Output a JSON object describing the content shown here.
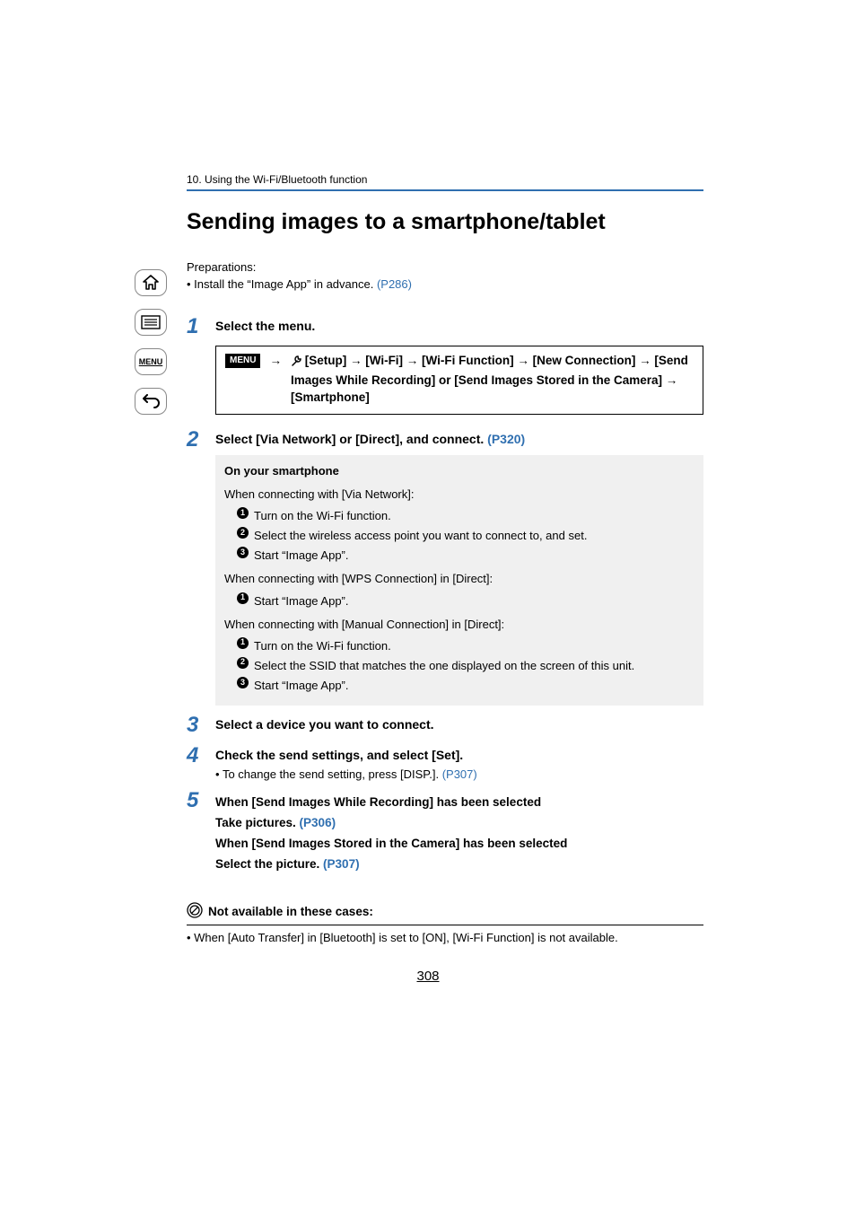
{
  "chapter": "10. Using the Wi-Fi/Bluetooth function",
  "title": "Sending images to a smartphone/tablet",
  "preparations": {
    "label": "Preparations:",
    "item_prefix": "• Install the “Image App” in advance. ",
    "item_link": "(P286)"
  },
  "steps": {
    "s1": {
      "num": "1",
      "title": "Select the menu.",
      "menu_badge": "MENU",
      "menu_path_pre_setup_arrow": " →   ",
      "menu_path_line1": " [Setup] → [Wi-Fi] → [Wi-Fi Function] → [New Connection] → [Send Images While Recording] or [Send Images Stored in the Camera] → [Smartphone]"
    },
    "s2": {
      "num": "2",
      "title_pre": "Select [Via Network] or [Direct], and connect. ",
      "title_link": "(P320)",
      "box": {
        "heading": "On your smartphone",
        "grp1_label": "When connecting with [Via Network]:",
        "grp1_items": [
          "Turn on the Wi-Fi function.",
          "Select the wireless access point you want to connect to, and set.",
          "Start “Image App”."
        ],
        "grp2_label": "When connecting with [WPS Connection] in [Direct]:",
        "grp2_items": [
          "Start “Image App”."
        ],
        "grp3_label": "When connecting with [Manual Connection] in [Direct]:",
        "grp3_items": [
          "Turn on the Wi-Fi function.",
          "Select the SSID that matches the one displayed on the screen of this unit.",
          "Start “Image App”."
        ]
      }
    },
    "s3": {
      "num": "3",
      "title": "Select a device you want to connect."
    },
    "s4": {
      "num": "4",
      "title": "Check the send settings, and select [Set].",
      "sub_prefix": "To change the send setting, press [DISP.]. ",
      "sub_link": "(P307)"
    },
    "s5": {
      "num": "5",
      "line1": "When [Send Images While Recording] has been selected",
      "line2_pre": "Take pictures. ",
      "line2_link": "(P306)",
      "line3": "When [Send Images Stored in the Camera] has been selected",
      "line4_pre": "Select the picture. ",
      "line4_link": "(P307)"
    }
  },
  "not_available": {
    "heading": "Not available in these cases:",
    "body": "• When [Auto Transfer] in [Bluetooth] is set to [ON], [Wi-Fi Function] is not available."
  },
  "page_number": "308",
  "sidebar": {
    "menu_label": "MENU"
  }
}
